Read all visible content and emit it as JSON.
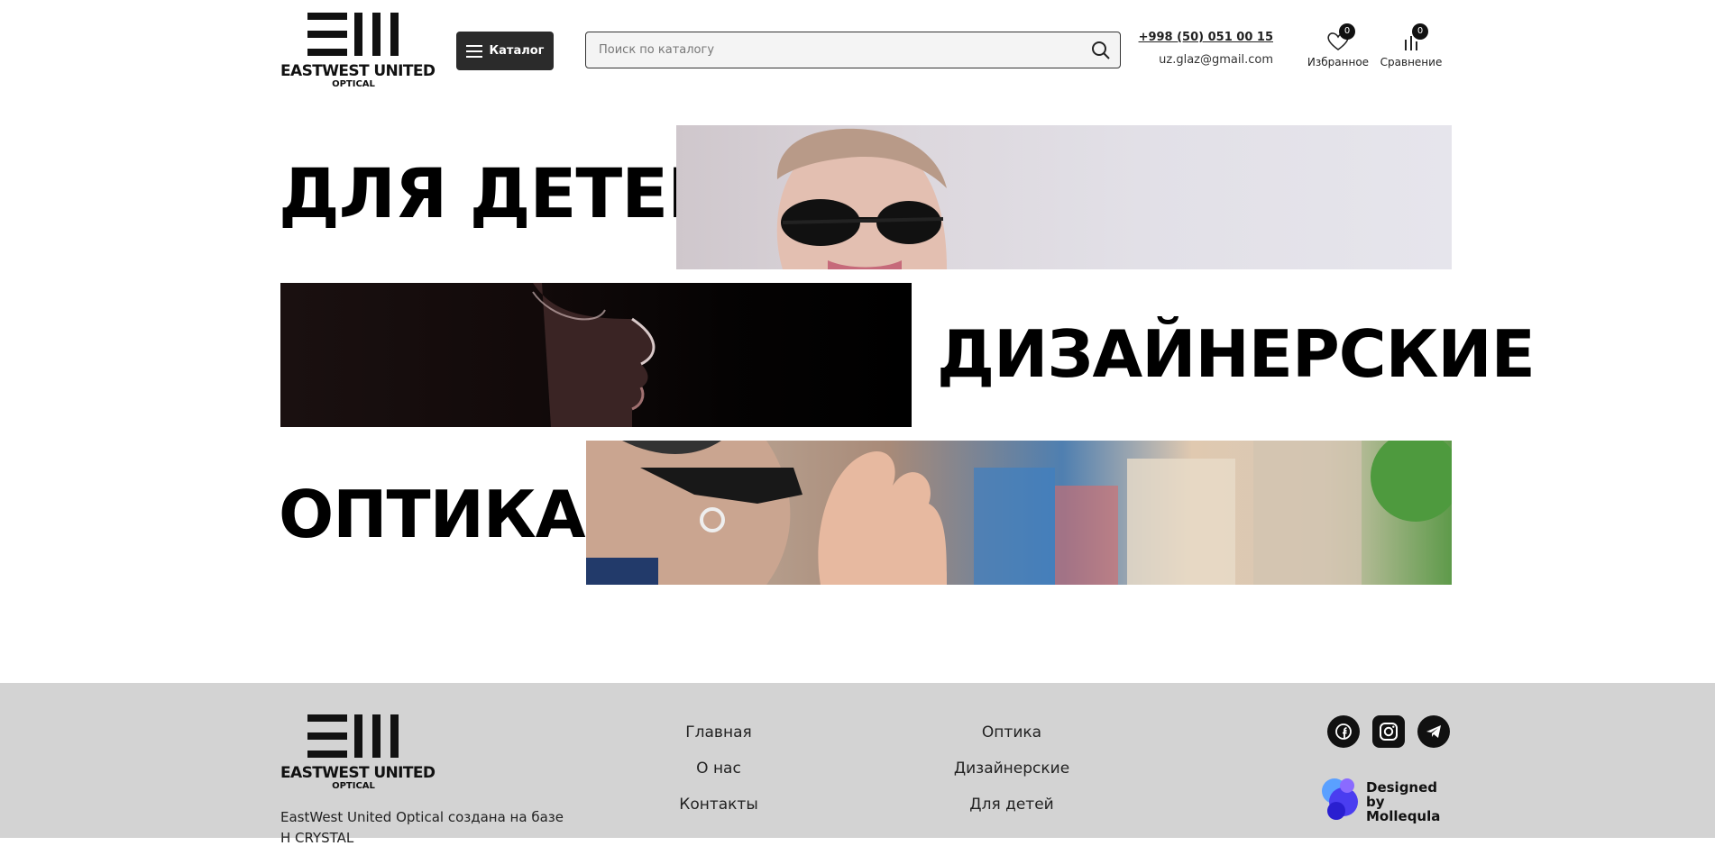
{
  "header": {
    "logo": {
      "wordmark": "EASTWEST UNITED",
      "sub": "OPTICAL"
    },
    "catalog_label": "Каталог",
    "search": {
      "placeholder": "Поиск по каталогу",
      "value": ""
    },
    "phone": "+998 (50) 051 00 15",
    "email": "uz.glaz@gmail.com",
    "favorites": {
      "label": "Избранное",
      "count": "0",
      "icon": "heart-icon"
    },
    "compare": {
      "label": "Сравнение",
      "count": "0",
      "icon": "compare-bars-icon"
    }
  },
  "banners": [
    {
      "title": "ДЛЯ ДЕТЕЙ"
    },
    {
      "title": "ДИЗАЙНЕРСКИЕ"
    },
    {
      "title": "ОПТИКА"
    }
  ],
  "footer": {
    "logo": {
      "wordmark": "EASTWEST UNITED",
      "sub": "OPTICAL"
    },
    "description": "EastWest United Optical создана на базе",
    "description_2": "Н                  CRYSTAL",
    "nav_col1": [
      "Главная",
      "О нас",
      "Контакты"
    ],
    "nav_col2": [
      "Оптика",
      "Дизайнерские",
      "Для детей"
    ],
    "social": [
      "facebook-icon",
      "instagram-icon",
      "telegram-icon"
    ],
    "designed_by": [
      "Designed by",
      "Mollequla"
    ]
  },
  "colors": {
    "dark_button": "#2b2b2b",
    "footer_bg": "#d3d3d3",
    "text": "#111111"
  }
}
